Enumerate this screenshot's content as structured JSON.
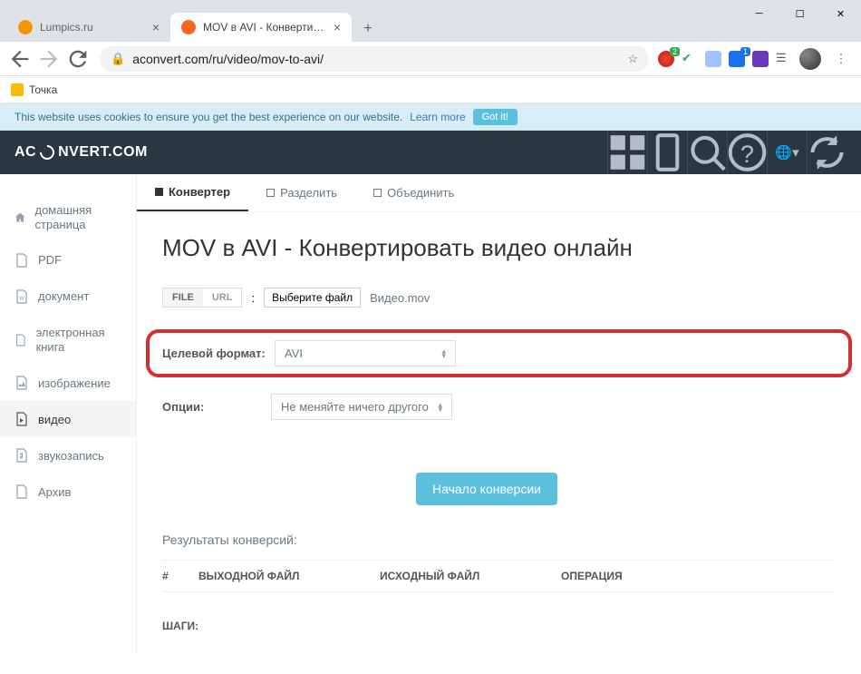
{
  "browser": {
    "tabs": [
      {
        "title": "Lumpics.ru",
        "fav_color": "#f29900",
        "active": false
      },
      {
        "title": "MOV в AVI - Конвертировать в…",
        "fav_color": "#f26522",
        "active": true
      }
    ],
    "url": "aconvert.com/ru/video/mov-to-avi/",
    "bookmark": "Точка"
  },
  "cookie": {
    "text": "This website uses cookies to ensure you get the best experience on our website.",
    "learn_more": "Learn more",
    "got_it": "Got it!"
  },
  "site": {
    "brand_pre": "AC",
    "brand_post": "NVERT.COM"
  },
  "sidebar": {
    "items": [
      {
        "label": "домашняя страница",
        "icon": "home"
      },
      {
        "label": "PDF",
        "icon": "pdf"
      },
      {
        "label": "документ",
        "icon": "doc"
      },
      {
        "label": "электронная книга",
        "icon": "ebook"
      },
      {
        "label": "изображение",
        "icon": "image"
      },
      {
        "label": "видео",
        "icon": "video",
        "active": true
      },
      {
        "label": "звукозапись",
        "icon": "audio"
      },
      {
        "label": "Архив",
        "icon": "archive"
      }
    ]
  },
  "main_tabs": {
    "convert": "Конвертер",
    "split": "Разделить",
    "merge": "Объединить"
  },
  "page": {
    "title": "MOV в AVI - Конвертировать видео онлайн",
    "src_file": "FILE",
    "src_url": "URL",
    "choose_file": "Выберите файл",
    "file_name": "Видео.mov",
    "target_format_label": "Целевой формат:",
    "target_format_value": "AVI",
    "options_label": "Опции:",
    "options_value": "Не меняйте ничего другого",
    "convert_button": "Начало конверсии",
    "results_title": "Результаты конверсий:",
    "col_num": "#",
    "col_output": "ВЫХОДНОЙ ФАЙЛ",
    "col_source": "ИСХОДНЫЙ ФАЙЛ",
    "col_operation": "ОПЕРАЦИЯ",
    "steps": "ШАГИ:"
  }
}
